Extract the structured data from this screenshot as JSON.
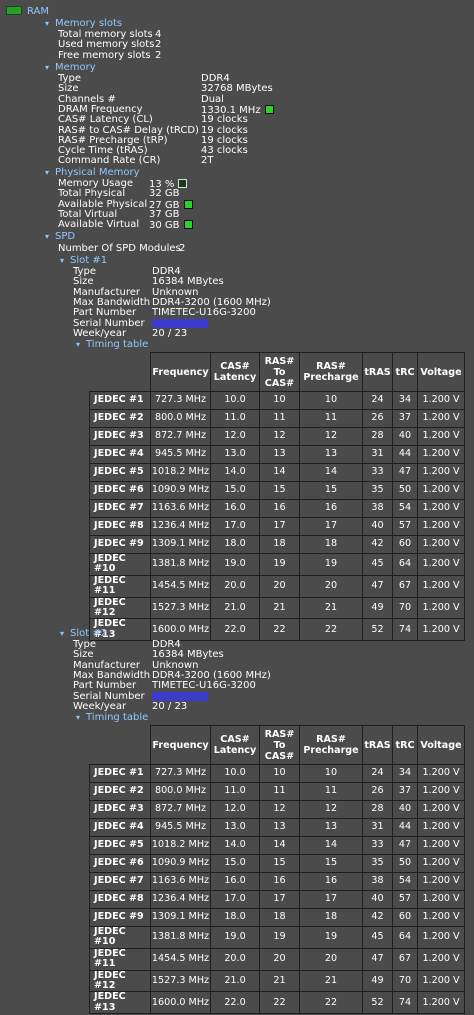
{
  "root": {
    "label": "RAM"
  },
  "memory_slots": {
    "label": "Memory slots",
    "rows": [
      {
        "label": "Total memory slots",
        "value": "4"
      },
      {
        "label": "Used memory slots",
        "value": "2"
      },
      {
        "label": "Free memory slots",
        "value": "2"
      }
    ]
  },
  "memory": {
    "label": "Memory",
    "rows": [
      {
        "label": "Type",
        "value": "DDR4"
      },
      {
        "label": "Size",
        "value": "32768 MBytes"
      },
      {
        "label": "Channels #",
        "value": "Dual"
      },
      {
        "label": "DRAM Frequency",
        "value": "1330.1 MHz"
      },
      {
        "label": "CAS# Latency (CL)",
        "value": "19 clocks"
      },
      {
        "label": "RAS# to CAS# Delay (tRCD)",
        "value": "19 clocks"
      },
      {
        "label": "RAS# Precharge (tRP)",
        "value": "19 clocks"
      },
      {
        "label": "Cycle Time (tRAS)",
        "value": "43 clocks"
      },
      {
        "label": "Command Rate (CR)",
        "value": "2T"
      }
    ]
  },
  "physical_memory": {
    "label": "Physical Memory",
    "rows": [
      {
        "label": "Memory Usage",
        "value": "13 %"
      },
      {
        "label": "Total Physical",
        "value": "32 GB"
      },
      {
        "label": "Available Physical",
        "value": "27 GB"
      },
      {
        "label": "Total Virtual",
        "value": "37 GB"
      },
      {
        "label": "Available Virtual",
        "value": "30 GB"
      }
    ]
  },
  "spd": {
    "label": "SPD",
    "modules_label": "Number Of SPD Modules",
    "modules_value": "2",
    "timing_label": "Timing table",
    "headers": [
      "Frequency",
      "CAS# Latency",
      "RAS# To CAS#",
      "RAS# Precharge",
      "tRAS",
      "tRC",
      "Voltage"
    ],
    "header_lines": [
      [
        "Frequency"
      ],
      [
        "CAS#",
        "Latency"
      ],
      [
        "RAS#",
        "To",
        "CAS#"
      ],
      [
        "RAS#",
        "Precharge"
      ],
      [
        "tRAS"
      ],
      [
        "tRC"
      ],
      [
        "Voltage"
      ]
    ],
    "slots": [
      {
        "label": "Slot #1",
        "info": [
          {
            "label": "Type",
            "value": "DDR4"
          },
          {
            "label": "Size",
            "value": "16384 MBytes"
          },
          {
            "label": "Manufacturer",
            "value": "Unknown"
          },
          {
            "label": "Max Bandwidth",
            "value": "DDR4-3200 (1600 MHz)"
          },
          {
            "label": "Part Number",
            "value": "TIMETEC-U16G-3200"
          },
          {
            "label": "Serial Number",
            "value": ""
          },
          {
            "label": "Week/year",
            "value": "20 / 23"
          }
        ]
      },
      {
        "label": "Slot #2",
        "info": [
          {
            "label": "Type",
            "value": "DDR4"
          },
          {
            "label": "Size",
            "value": "16384 MBytes"
          },
          {
            "label": "Manufacturer",
            "value": "Unknown"
          },
          {
            "label": "Max Bandwidth",
            "value": "DDR4-3200 (1600 MHz)"
          },
          {
            "label": "Part Number",
            "value": "TIMETEC-U16G-3200"
          },
          {
            "label": "Serial Number",
            "value": ""
          },
          {
            "label": "Week/year",
            "value": "20 / 23"
          }
        ]
      }
    ],
    "timing_rows": [
      [
        "JEDEC #1",
        "727.3 MHz",
        "10.0",
        "10",
        "10",
        "24",
        "34",
        "1.200 V"
      ],
      [
        "JEDEC #2",
        "800.0 MHz",
        "11.0",
        "11",
        "11",
        "26",
        "37",
        "1.200 V"
      ],
      [
        "JEDEC #3",
        "872.7 MHz",
        "12.0",
        "12",
        "12",
        "28",
        "40",
        "1.200 V"
      ],
      [
        "JEDEC #4",
        "945.5 MHz",
        "13.0",
        "13",
        "13",
        "31",
        "44",
        "1.200 V"
      ],
      [
        "JEDEC #5",
        "1018.2 MHz",
        "14.0",
        "14",
        "14",
        "33",
        "47",
        "1.200 V"
      ],
      [
        "JEDEC #6",
        "1090.9 MHz",
        "15.0",
        "15",
        "15",
        "35",
        "50",
        "1.200 V"
      ],
      [
        "JEDEC #7",
        "1163.6 MHz",
        "16.0",
        "16",
        "16",
        "38",
        "54",
        "1.200 V"
      ],
      [
        "JEDEC #8",
        "1236.4 MHz",
        "17.0",
        "17",
        "17",
        "40",
        "57",
        "1.200 V"
      ],
      [
        "JEDEC #9",
        "1309.1 MHz",
        "18.0",
        "18",
        "18",
        "42",
        "60",
        "1.200 V"
      ],
      [
        "JEDEC #10",
        "1381.8 MHz",
        "19.0",
        "19",
        "19",
        "45",
        "64",
        "1.200 V"
      ],
      [
        "JEDEC #11",
        "1454.5 MHz",
        "20.0",
        "20",
        "20",
        "47",
        "67",
        "1.200 V"
      ],
      [
        "JEDEC #12",
        "1527.3 MHz",
        "21.0",
        "21",
        "21",
        "49",
        "70",
        "1.200 V"
      ],
      [
        "JEDEC #13",
        "1600.0 MHz",
        "22.0",
        "22",
        "22",
        "52",
        "74",
        "1.200 V"
      ]
    ]
  },
  "colors": {
    "background": "#4b4b4b",
    "section": "#8fc8ff",
    "indicator": "#2cd12c",
    "serial_redaction": "#3c3ccc"
  },
  "icons": {
    "expanded": "triangle-down",
    "root": "ram-chip-icon"
  }
}
